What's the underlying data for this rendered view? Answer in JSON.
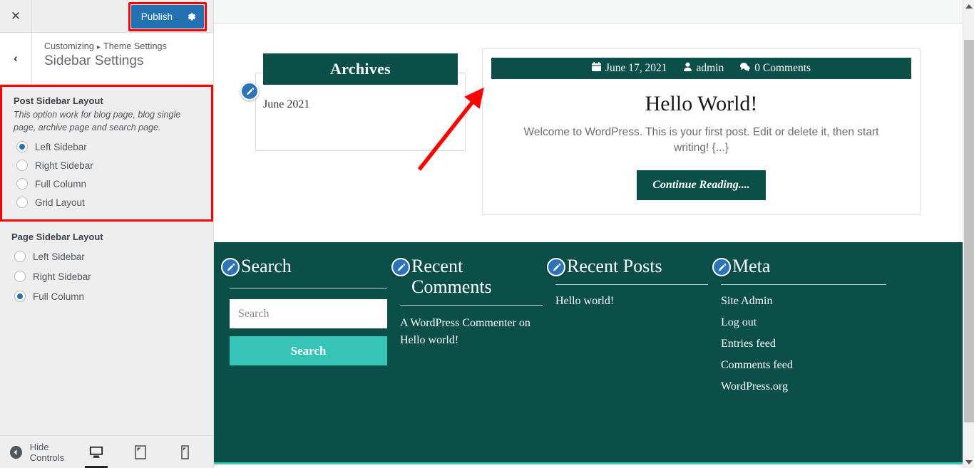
{
  "customizer": {
    "close_label": "✕",
    "back_label": "‹",
    "publish_label": "Publish",
    "breadcrumb_root": "Customizing",
    "breadcrumb_sep": "▸",
    "breadcrumb_parent": "Theme Settings",
    "panel_title": "Sidebar Settings",
    "accent_blue": "#2271b1",
    "highlight_red": "#ff0000",
    "sections": [
      {
        "label": "Post Sidebar Layout",
        "description": "This option work for blog page, blog single page, archive page and search page.",
        "highlighted": true,
        "options": [
          {
            "label": "Left Sidebar",
            "checked": true
          },
          {
            "label": "Right Sidebar",
            "checked": false
          },
          {
            "label": "Full Column",
            "checked": false
          },
          {
            "label": "Grid Layout",
            "checked": false
          }
        ]
      },
      {
        "label": "Page Sidebar Layout",
        "description": "",
        "highlighted": false,
        "options": [
          {
            "label": "Left Sidebar",
            "checked": false
          },
          {
            "label": "Right Sidebar",
            "checked": false
          },
          {
            "label": "Full Column",
            "checked": true
          }
        ]
      }
    ],
    "footer": {
      "hide_controls_label": "Hide Controls",
      "devices": [
        {
          "name": "desktop",
          "active": true
        },
        {
          "name": "tablet",
          "active": false
        },
        {
          "name": "mobile",
          "active": false
        }
      ]
    }
  },
  "preview": {
    "theme_dark": "#0b4f48",
    "theme_accent": "#35c4b5",
    "archives_widget": {
      "title": "Archives",
      "items": [
        "June 2021"
      ]
    },
    "post": {
      "date": "June 17, 2021",
      "author": "admin",
      "comments": "0 Comments",
      "title": "Hello World!",
      "excerpt": "Welcome to WordPress. This is your first post. Edit or delete it, then start writing! {...}",
      "read_more_label": "Continue Reading...."
    },
    "footer_widgets": [
      {
        "title": "Search",
        "search_placeholder": "Search",
        "search_button_label": "Search"
      },
      {
        "title": "Recent Comments",
        "text": "A WordPress Commenter on Hello world!"
      },
      {
        "title": "Recent Posts",
        "links": [
          "Hello world!"
        ]
      },
      {
        "title": "Meta",
        "links": [
          "Site Admin",
          "Log out",
          "Entries feed",
          "Comments feed",
          "WordPress.org"
        ]
      }
    ]
  }
}
